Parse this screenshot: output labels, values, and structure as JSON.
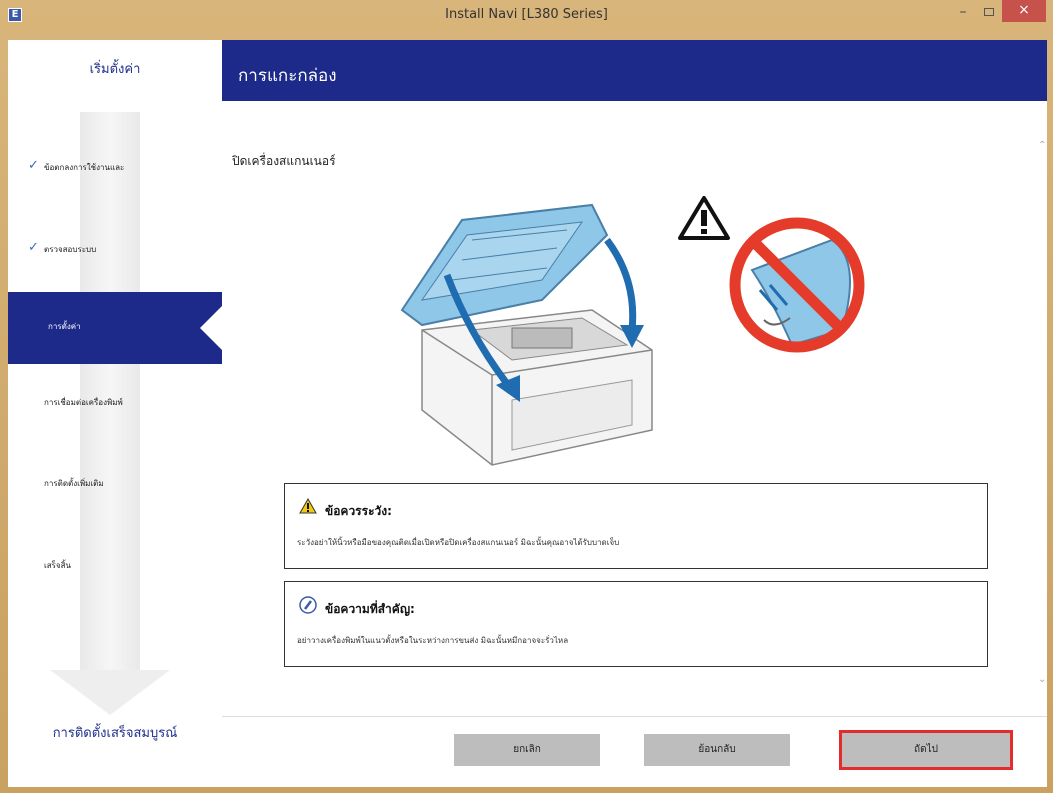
{
  "window": {
    "app_icon": "E",
    "title": "Install Navi [L380 Series]",
    "minimize_label": "–",
    "close_label": "×"
  },
  "sidebar": {
    "title": "เริ่มตั้งค่า",
    "steps": [
      {
        "label": "ข้อตกลงการใช้งานและ",
        "done": true
      },
      {
        "label": "ตรวจสอบระบบ",
        "done": true
      },
      {
        "label": "การตั้งค่า",
        "active": true
      },
      {
        "label": "การเชื่อมต่อเครื่องพิมพ์",
        "done": false
      },
      {
        "label": "การติดตั้งเพิ่มเติม",
        "done": false
      },
      {
        "label": "เสร็จสิ้น",
        "done": false
      }
    ],
    "footer": "การติดตั้งเสร็จสมบูรณ์"
  },
  "main": {
    "header_title": "การแกะกล่อง",
    "section_title": "ปิดเครื่องสแกนเนอร์",
    "caution": {
      "title": "ข้อควรระวัง:",
      "body": "ระวังอย่าให้นิ้วหรือมือของคุณติดเมื่อเปิดหรือปิดเครื่องสแกนเนอร์ มิฉะนั้นคุณอาจได้รับบาดเจ็บ"
    },
    "important": {
      "title": "ข้อความที่สำคัญ:",
      "body": "อย่าวางเครื่องพิมพ์ในแนวตั้งหรือในระหว่างการขนส่ง มิฉะนั้นหมึกอาจจะรั่วไหล"
    }
  },
  "buttons": {
    "cancel": "ยกเลิก",
    "back": "ย้อนกลับ",
    "next": "ถัดไป"
  },
  "icons": {
    "warning": "warning-icon",
    "important": "important-icon",
    "check": "check-icon"
  },
  "colors": {
    "header_bg": "#1e2a8a",
    "highlight": "#e52b2b",
    "printer_lid": "#8ec7e8",
    "arrow": "#1f6cb0",
    "prohibit": "#e53b2b"
  }
}
